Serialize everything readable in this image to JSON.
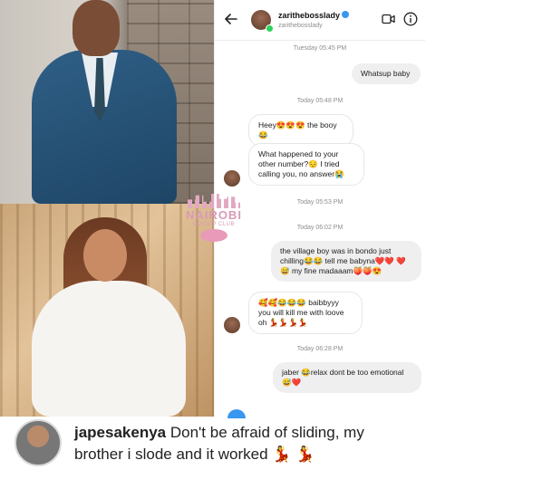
{
  "chat": {
    "header": {
      "name": "zarithebosslady",
      "username": "zarithebosslady"
    },
    "messages": [
      {
        "kind": "timestamp",
        "text": "Tuesday 05:45 PM"
      },
      {
        "kind": "outgoing",
        "text": "Whatsup baby"
      },
      {
        "kind": "timestamp",
        "text": "Today 05:48 PM"
      },
      {
        "kind": "incoming",
        "text": "Heey😍😍😍 the booy😂"
      },
      {
        "kind": "incoming",
        "text": "What happened to your other number?😔 I tried calling you, no answer😭"
      },
      {
        "kind": "timestamp",
        "text": "Today 05:53 PM"
      },
      {
        "kind": "timestamp",
        "text": "Today 06:02 PM"
      },
      {
        "kind": "outgoing",
        "text": "the village boy was in bondo just chilling😂😂 tell me babyna❤️❤️ ❤️😅 my fine madaaam🍑🍑😍"
      },
      {
        "kind": "incoming",
        "text": "🥰🥰😂😂😂 baibbyyy you will kill me with loove oh 💃💃💃💃"
      },
      {
        "kind": "timestamp",
        "text": "Today 06:28 PM"
      },
      {
        "kind": "outgoing",
        "text": "jaber 😂relax dont be too emotional😅❤️"
      }
    ]
  },
  "watermark": {
    "title": "NAIROBI",
    "subtitle": "GOSSIP CLUB"
  },
  "caption": {
    "username": "japesakenya",
    "text": " Don't be afraid of sliding, my brother i slode and it worked 💃 💃"
  }
}
